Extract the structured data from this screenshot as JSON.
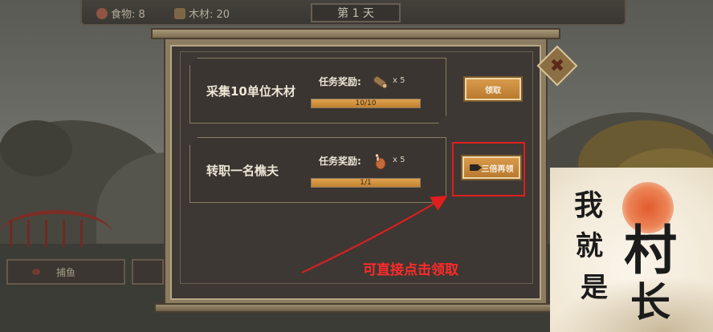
{
  "hud": {
    "food_label": "食物: 8",
    "wood_label": "木材: 20",
    "day_label": "第 1 天"
  },
  "background_buttons": {
    "fish_label": "捕鱼"
  },
  "tasks": [
    {
      "title": "采集10单位木材",
      "reward_label": "任务奖励:",
      "reward_icon": "wood-log-icon",
      "reward_count": "x 5",
      "progress_text": "10/10",
      "progress": 1.0,
      "button_label": "领取"
    },
    {
      "title": "转职一名樵夫",
      "reward_label": "任务奖励:",
      "reward_icon": "meat-drumstick-icon",
      "reward_count": "x 5",
      "progress_text": "1/1",
      "progress": 1.0,
      "button_label": "三倍再领"
    }
  ],
  "annotation": {
    "hint_text": "可直接点击领取",
    "color": "#e01e1e"
  },
  "logo": {
    "chars": [
      "我",
      "就",
      "是",
      "村",
      "长"
    ]
  },
  "colors": {
    "button_orange": "#d89a4a",
    "panel_dark": "#3d3833",
    "frame_gold": "#b7a685"
  }
}
